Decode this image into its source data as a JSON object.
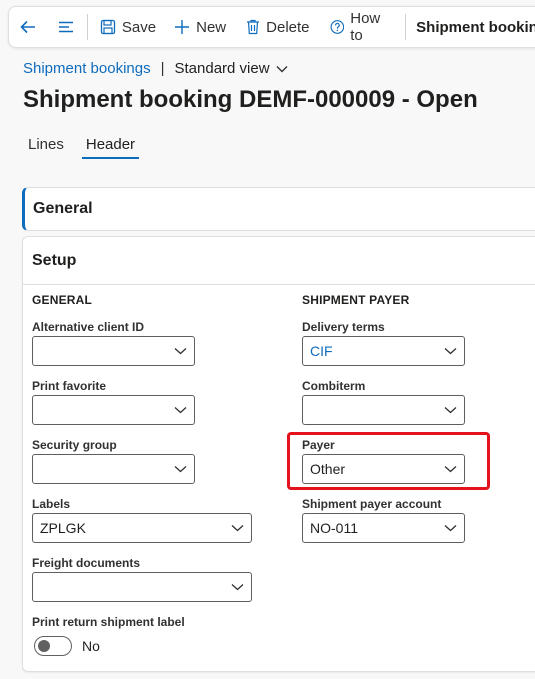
{
  "toolbar": {
    "save_label": "Save",
    "new_label": "New",
    "delete_label": "Delete",
    "howto_label": "How to",
    "title": "Shipment booking"
  },
  "breadcrumb": {
    "link": "Shipment bookings",
    "separator": "|",
    "view": "Standard view"
  },
  "page_title": "Shipment booking DEMF-000009 - Open",
  "tabs": [
    {
      "label": "Lines"
    },
    {
      "label": "Header"
    }
  ],
  "general_card": {
    "title": "General"
  },
  "setup": {
    "title": "Setup",
    "general_section": {
      "heading": "GENERAL",
      "alt_client_id": {
        "label": "Alternative client ID",
        "value": ""
      },
      "print_favorite": {
        "label": "Print favorite",
        "value": ""
      },
      "security_group": {
        "label": "Security group",
        "value": ""
      },
      "labels": {
        "label": "Labels",
        "value": "ZPLGK"
      },
      "freight_documents": {
        "label": "Freight documents",
        "value": ""
      },
      "print_return_label": {
        "label": "Print return shipment label",
        "value": "No"
      }
    },
    "payer_section": {
      "heading": "SHIPMENT PAYER",
      "delivery_terms": {
        "label": "Delivery terms",
        "value": "CIF"
      },
      "combiterm": {
        "label": "Combiterm",
        "value": ""
      },
      "payer": {
        "label": "Payer",
        "value": "Other"
      },
      "payer_account": {
        "label": "Shipment payer account",
        "value": "NO-011"
      }
    }
  },
  "colors": {
    "accent": "#0f6cbd",
    "highlight": "#e3121c"
  }
}
